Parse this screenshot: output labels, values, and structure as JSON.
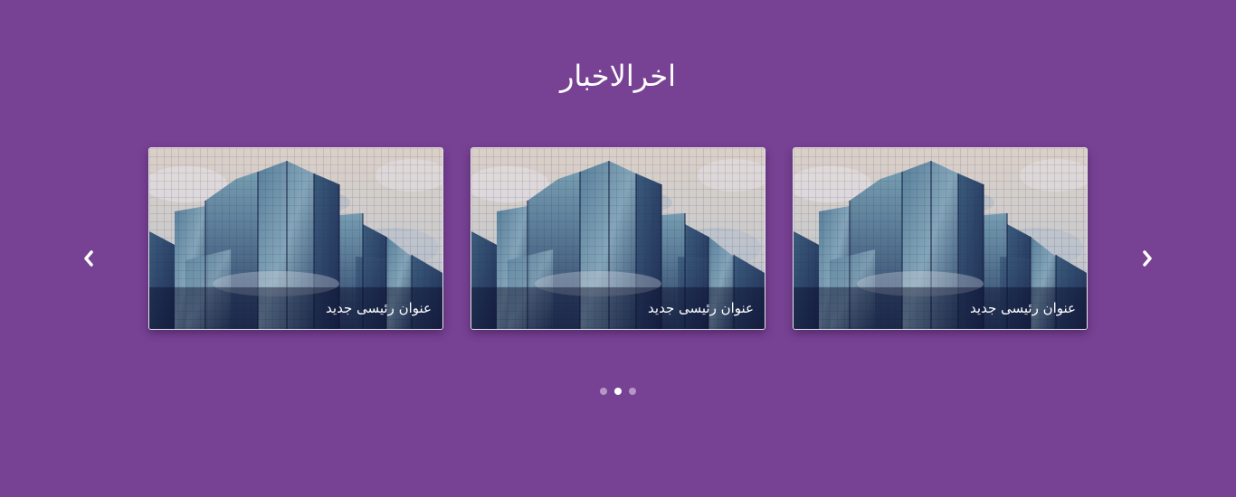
{
  "section": {
    "title": "اخرالاخبار"
  },
  "carousel": {
    "prev_icon": "chevron-left-icon",
    "next_icon": "chevron-right-icon",
    "cards": [
      {
        "caption": "عنوان رئيسى جديد"
      },
      {
        "caption": "عنوان رئيسى جديد"
      },
      {
        "caption": "عنوان رئيسى جديد"
      }
    ],
    "dots": {
      "count": 3,
      "active_index": 1
    }
  },
  "colors": {
    "background": "#784294",
    "caption_overlay": "rgba(8,10,40,0.45)",
    "dot_active": "#ffffff"
  }
}
